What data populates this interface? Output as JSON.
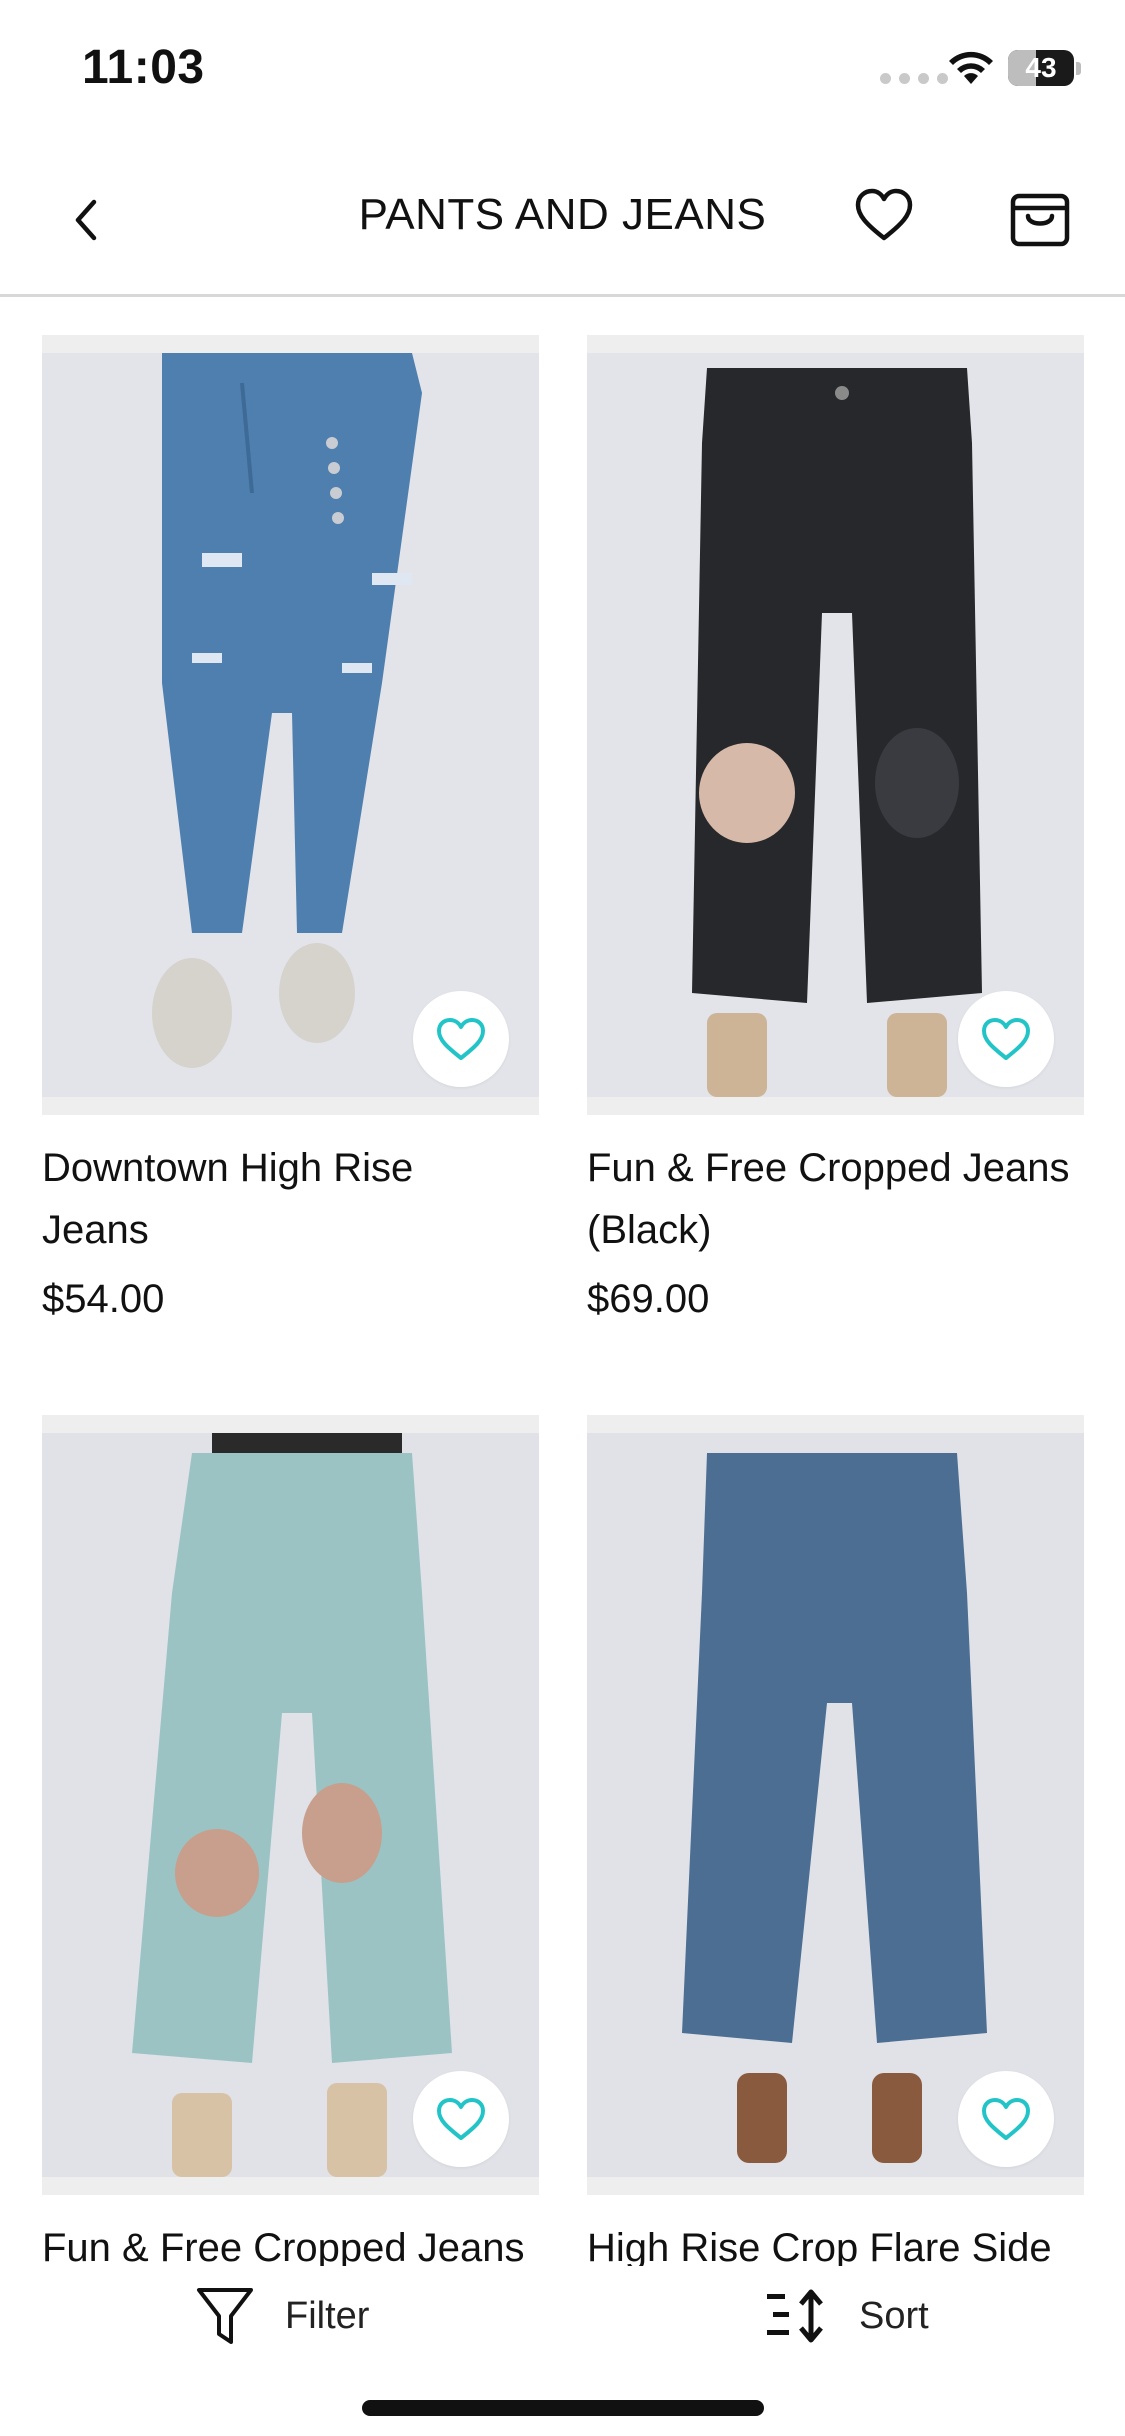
{
  "status_bar": {
    "time": "11:03",
    "battery": "43",
    "battery_fraction": 0.43
  },
  "header": {
    "title": "PANTS AND JEANS",
    "icons": [
      "chevron-left-icon",
      "heart-icon",
      "shopping-bag-icon"
    ]
  },
  "products": [
    {
      "name": "Downtown High Rise Jeans",
      "price": "$54.00",
      "wishlist_color": "#22c4c8"
    },
    {
      "name": "Fun & Free Cropped Jeans (Black)",
      "price": "$69.00",
      "wishlist_color": "#22c4c8"
    },
    {
      "name": "Fun & Free Cropped Jeans",
      "price": "",
      "wishlist_color": "#22c4c8"
    },
    {
      "name": "High Rise Crop Flare Side",
      "price": "",
      "wishlist_color": "#22c4c8"
    }
  ],
  "bottom_bar": {
    "filter_label": "Filter",
    "sort_label": "Sort"
  },
  "colors": {
    "accent": "#22c4c8",
    "divider": "#d8d8d8"
  }
}
